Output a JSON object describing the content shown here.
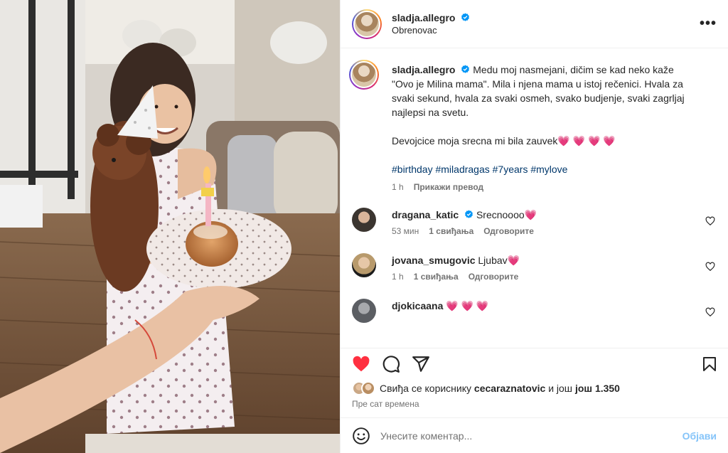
{
  "post": {
    "username": "sladja.allegro",
    "location": "Obrenovac",
    "more_label": "•••"
  },
  "caption": {
    "username": "sladja.allegro",
    "text": "Medu moj nasmejani, dičim se kad neko kaže \"Ovo je Milina mama\". Mila i njena mama u istoj rečenici. Hvala za svaki sekund, hvala za svaki osmeh, svako budjenje, svaki zagrljaj najlepsi na svetu.",
    "text2": "Devojcice moja srecna mi bila zauvek💗 💗 💗 💗",
    "hashtags": "#birthday #miladragas #7years #mylove",
    "time": "1 h",
    "translate": "Прикажи превод"
  },
  "comments": [
    {
      "username": "dragana_katic",
      "verified": true,
      "text": "Srecnoooo💗",
      "time": "53 мин",
      "likes": "1 свиђања",
      "reply": "Одговорите",
      "avatar_color": "#3b3530"
    },
    {
      "username": "jovana_smugovic",
      "verified": false,
      "text": "Ljubav💗",
      "time": "1 h",
      "likes": "1 свиђања",
      "reply": "Одговорите",
      "avatar_color": "#b89a6c"
    },
    {
      "username": "djokicaana",
      "verified": false,
      "text": "💗 💗 💗",
      "time": "",
      "likes": "",
      "reply": "",
      "avatar_color": "#5b5e63"
    }
  ],
  "likes": {
    "prefix": "Свиђа се кориснику",
    "user": "cecaraznatovic",
    "middle": "и још",
    "count": "још 1.350"
  },
  "timestamp": "Пре сат времена",
  "composer": {
    "placeholder": "Унесите коментар...",
    "post_label": "Објави"
  },
  "colors": {
    "like_red": "#ff3040",
    "link_blue": "#00376b",
    "verified_blue": "#0095f6",
    "post_button": "#85c4f9"
  },
  "icons": [
    "verified-badge-icon",
    "more-options-icon",
    "heart-icon",
    "comment-icon",
    "share-icon",
    "bookmark-icon",
    "emoji-icon"
  ]
}
